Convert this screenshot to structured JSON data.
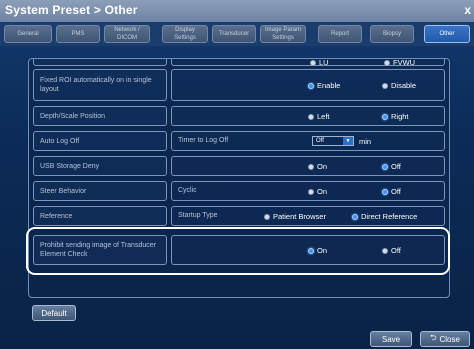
{
  "window": {
    "title": "System Preset > Other",
    "close_glyph": "x"
  },
  "tabs": [
    {
      "label": "General"
    },
    {
      "label": "PMS"
    },
    {
      "label": "Network / DICOM"
    },
    {
      "label": "Display Settings"
    },
    {
      "label": "Transducer"
    },
    {
      "label": "Image Param Settings"
    },
    {
      "label": "Report"
    },
    {
      "label": "Biopsy"
    },
    {
      "label": "Other",
      "active": true
    }
  ],
  "rows": {
    "partial": {
      "opt1": "LU",
      "opt2": "FVWU"
    },
    "fixed_roi": {
      "label": "Fixed ROI automatically on in single layout",
      "opt_enable": "Enable",
      "opt_disable": "Disable",
      "selected": "Enable"
    },
    "depth_scale": {
      "label": "Depth/Scale Position",
      "opt_left": "Left",
      "opt_right": "Right",
      "selected": "Right"
    },
    "auto_logoff": {
      "label": "Auto Log Off",
      "sub_label": "Timer to Log Off",
      "value": "Off",
      "unit": "min"
    },
    "usb_storage": {
      "label": "USB Storage Deny",
      "opt_on": "On",
      "opt_off": "Off",
      "selected": "Off"
    },
    "steer": {
      "label": "Steer Behavior",
      "sub_label": "Cyclic",
      "opt_on": "On",
      "opt_off": "Off",
      "selected": "Off"
    },
    "reference": {
      "label": "Reference",
      "sub_label": "Startup Type",
      "opt_patient": "Patient Browser",
      "opt_direct": "Direct Reference",
      "selected": "Direct Reference"
    },
    "prohibit": {
      "label": "Prohibit sending image of Transducer Element Check",
      "opt_on": "On",
      "opt_off": "Off",
      "selected": "On"
    }
  },
  "buttons": {
    "default": "Default",
    "save": "Save",
    "close": "Close"
  },
  "colors": {
    "accent": "#3b95ff",
    "background": "#0c2b57",
    "highlight_border": "#ffffff"
  }
}
